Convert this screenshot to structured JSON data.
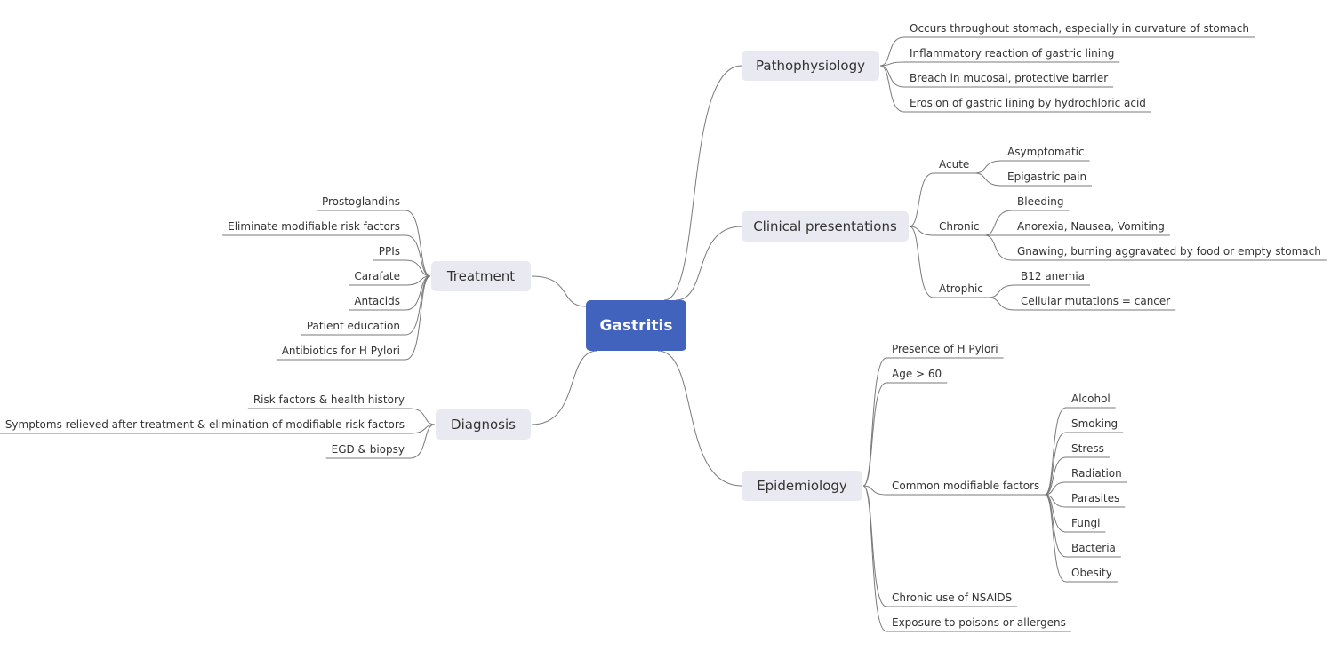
{
  "central_topic": "Gastritis",
  "colors": {
    "central_fill": "#4263bd",
    "topic_fill": "#e9e9f1",
    "line": "#7a7a7a",
    "text": "#333333"
  },
  "branches": {
    "pathophysiology": {
      "label": "Pathophysiology",
      "items": [
        "Occurs throughout stomach, especially in curvature of stomach",
        "Inflammatory reaction of gastric lining",
        "Breach in mucosal, protective barrier",
        "Erosion of gastric lining by hydrochloric acid"
      ]
    },
    "clinical": {
      "label": "Clinical presentations",
      "groups": [
        {
          "label": "Acute",
          "items": [
            "Asymptomatic",
            "Epigastric pain"
          ]
        },
        {
          "label": "Chronic",
          "items": [
            "Bleeding",
            "Anorexia, Nausea, Vomiting",
            "Gnawing, burning aggravated by food or empty stomach"
          ]
        },
        {
          "label": "Atrophic",
          "items": [
            "B12 anemia",
            "Cellular mutations = cancer"
          ]
        }
      ]
    },
    "epidemiology": {
      "label": "Epidemiology",
      "items": [
        "Presence of H Pylori",
        "Age > 60",
        "Common modifiable factors",
        "Chronic use of NSAIDS",
        "Exposure to poisons or allergens"
      ],
      "modifiable_factors": [
        "Alcohol",
        "Smoking",
        "Stress",
        "Radiation",
        "Parasites",
        "Fungi",
        "Bacteria",
        "Obesity"
      ]
    },
    "treatment": {
      "label": "Treatment",
      "items": [
        "Prostoglandins",
        "Eliminate modifiable risk factors",
        "PPIs",
        "Carafate",
        "Antacids",
        "Patient education",
        "Antibiotics for H Pylori"
      ]
    },
    "diagnosis": {
      "label": "Diagnosis",
      "items": [
        "Risk factors & health history",
        "Symptoms relieved after treatment & elimination of modifiable risk factors",
        "EGD & biopsy"
      ]
    }
  }
}
